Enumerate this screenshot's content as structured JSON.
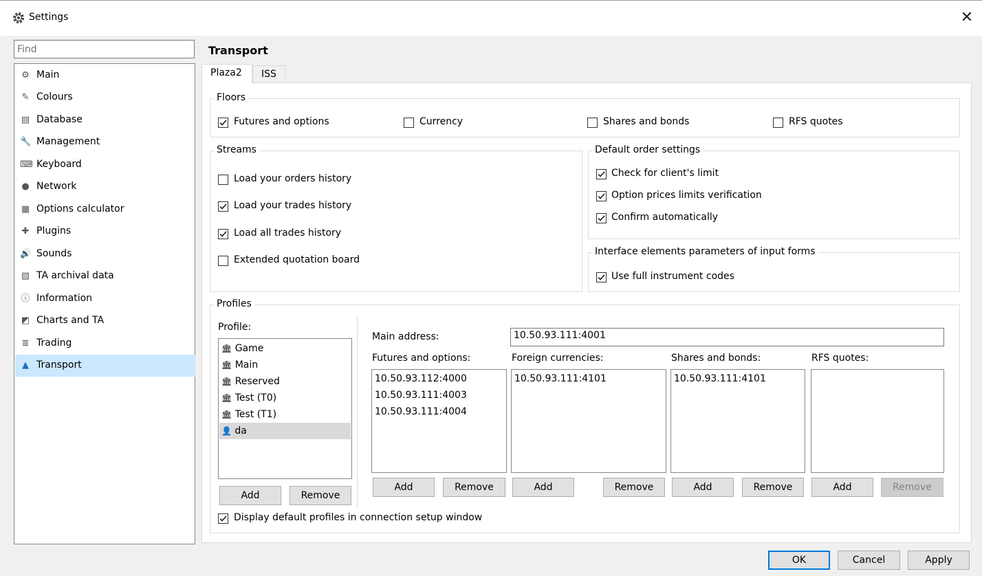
{
  "window": {
    "title": "Settings",
    "close_glyph": "✕"
  },
  "search": {
    "placeholder": "Find"
  },
  "nav": {
    "items": [
      {
        "label": "Main",
        "icon": "gear-icon",
        "glyph": "⚙"
      },
      {
        "label": "Colours",
        "icon": "brush-icon",
        "glyph": "✎"
      },
      {
        "label": "Database",
        "icon": "database-icon",
        "glyph": "▤"
      },
      {
        "label": "Management",
        "icon": "wrench-icon",
        "glyph": "🔧"
      },
      {
        "label": "Keyboard",
        "icon": "keyboard-icon",
        "glyph": "⌨"
      },
      {
        "label": "Network",
        "icon": "network-icon",
        "glyph": "●"
      },
      {
        "label": "Options calculator",
        "icon": "calculator-icon",
        "glyph": "▦"
      },
      {
        "label": "Plugins",
        "icon": "puzzle-icon",
        "glyph": "✚"
      },
      {
        "label": "Sounds",
        "icon": "speaker-icon",
        "glyph": "🔊"
      },
      {
        "label": "TA archival data",
        "icon": "archive-chart-icon",
        "glyph": "▧"
      },
      {
        "label": "Information",
        "icon": "info-icon",
        "glyph": "ⓘ"
      },
      {
        "label": "Charts and TA",
        "icon": "chart-icon",
        "glyph": "◩"
      },
      {
        "label": "Trading",
        "icon": "coins-icon",
        "glyph": "≣"
      },
      {
        "label": "Transport",
        "icon": "transport-icon",
        "glyph": "▲",
        "selected": true
      }
    ]
  },
  "page": {
    "heading": "Transport"
  },
  "tabs": [
    {
      "label": "Plaza2",
      "active": true
    },
    {
      "label": "ISS",
      "active": false
    }
  ],
  "floors": {
    "title": "Floors",
    "items": [
      {
        "label": "Futures and options",
        "checked": true
      },
      {
        "label": "Currency",
        "checked": false
      },
      {
        "label": "Shares and bonds",
        "checked": false
      },
      {
        "label": "RFS quotes",
        "checked": false
      }
    ]
  },
  "streams": {
    "title": "Streams",
    "items": [
      {
        "label": "Load your orders history",
        "checked": false
      },
      {
        "label": "Load your trades history",
        "checked": true
      },
      {
        "label": "Load all trades history",
        "checked": true
      },
      {
        "label": "Extended quotation board",
        "checked": false
      }
    ]
  },
  "default_order": {
    "title": "Default order settings",
    "items": [
      {
        "label": "Check for client's limit",
        "checked": true
      },
      {
        "label": "Option prices limits verification",
        "checked": true
      },
      {
        "label": "Confirm automatically",
        "checked": true
      }
    ]
  },
  "interface": {
    "title": "Interface elements parameters of input forms",
    "items": [
      {
        "label": "Use full instrument codes",
        "checked": true
      }
    ]
  },
  "profiles": {
    "title": "Profiles",
    "list_label": "Profile:",
    "items": [
      {
        "label": "Game",
        "icon": "bank-icon",
        "glyph": "🏛"
      },
      {
        "label": "Main",
        "icon": "bank-icon",
        "glyph": "🏛"
      },
      {
        "label": "Reserved",
        "icon": "bank-icon",
        "glyph": "🏛"
      },
      {
        "label": "Test (T0)",
        "icon": "bank-icon",
        "glyph": "🏛"
      },
      {
        "label": "Test (T1)",
        "icon": "bank-icon",
        "glyph": "🏛"
      },
      {
        "label": "da",
        "icon": "user-icon",
        "glyph": "👤",
        "selected": true
      }
    ],
    "add_label": "Add",
    "remove_label": "Remove",
    "main_address_label": "Main address:",
    "main_address_value": "10.50.93.111:4001",
    "columns": [
      {
        "label": "Futures and options:",
        "values": [
          "10.50.93.112:4000",
          "10.50.93.111:4003",
          "10.50.93.111:4004"
        ],
        "add": "Add",
        "remove": "Remove",
        "remove_disabled": false
      },
      {
        "label": "Foreign currencies:",
        "values": [
          "10.50.93.111:4101"
        ],
        "add": "Add",
        "remove": "Remove",
        "remove_disabled": false
      },
      {
        "label": "Shares and bonds:",
        "values": [
          "10.50.93.111:4101"
        ],
        "add": "Add",
        "remove": "Remove",
        "remove_disabled": false
      },
      {
        "label": "RFS quotes:",
        "values": [],
        "add": "Add",
        "remove": "Remove",
        "remove_disabled": true
      }
    ],
    "display_default": {
      "label": "Display default profiles in connection setup window",
      "checked": true
    }
  },
  "footer": {
    "ok": "OK",
    "cancel": "Cancel",
    "apply": "Apply"
  },
  "colors": {
    "selection": "#cce8ff",
    "accent": "#0078d7",
    "nav_icon_accent": "#1e6fb8"
  }
}
